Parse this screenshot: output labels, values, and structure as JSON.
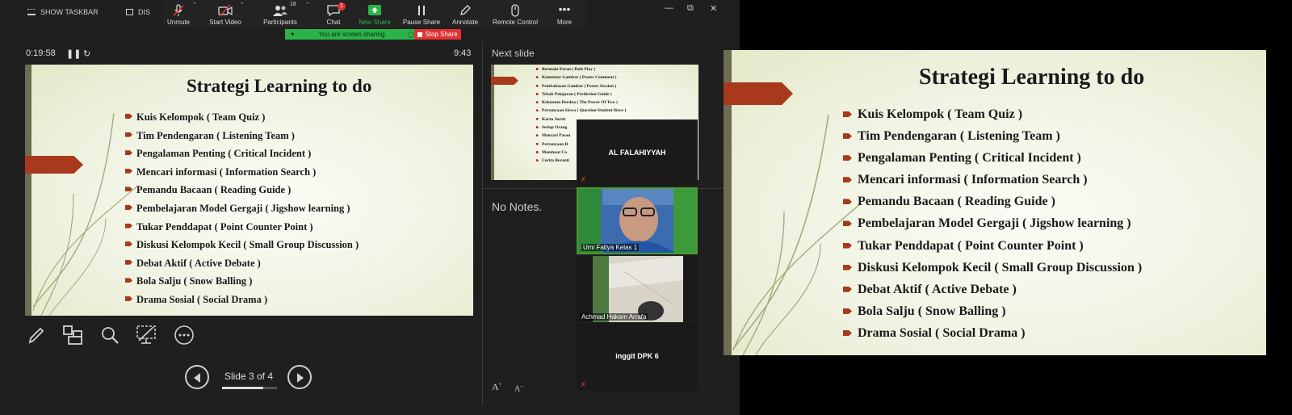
{
  "taskbar": {
    "show_taskbar": "SHOW TASKBAR",
    "disp": "DIS"
  },
  "zoom": {
    "participants_count": "18",
    "chat_badge": "1",
    "items": [
      {
        "label": "Unmute",
        "icon": "mic-muted-icon"
      },
      {
        "label": "Start Video",
        "icon": "video-off-icon"
      },
      {
        "label": "Participants",
        "icon": "participants-icon"
      },
      {
        "label": "Chat",
        "icon": "chat-icon"
      },
      {
        "label": "New Share",
        "icon": "share-icon"
      },
      {
        "label": "Pause Share",
        "icon": "pause-icon"
      },
      {
        "label": "Annotate",
        "icon": "pencil-icon"
      },
      {
        "label": "Remote Control",
        "icon": "mouse-icon"
      },
      {
        "label": "More",
        "icon": "more-icon"
      }
    ],
    "sharing_text": "You are screen sharing",
    "stop_share": "Stop Share",
    "share_color": "#2bb34a",
    "stop_color": "#e03333"
  },
  "presenter": {
    "elapsed": "0:19:58",
    "clock": "9:43",
    "next_slide_label": "Next slide",
    "notes": "No Notes.",
    "slide_counter": "Slide 3 of 4",
    "slide_progress": 0.75,
    "font_increase": "A",
    "font_decrease": "A"
  },
  "slide": {
    "title": "Strategi Learning to do",
    "items": [
      "Kuis Kelompok ( Team Quiz )",
      "Tim Pendengaran ( Listening Team )",
      "Pengalaman Penting ( Critical Incident )",
      "Mencari informasi ( Information Search )",
      "Pemandu Bacaan ( Reading Guide )",
      "Pembelajaran Model Gergaji ( Jigshow learning )",
      "Tukar Penddapat ( Point Counter Point )",
      "Diskusi Kelompok Kecil ( Small Group Discussion )",
      " Debat Aktif ( Active Debate )",
      " Bola Salju ( Snow Balling )",
      "Drama Sosial ( Social Drama )"
    ],
    "accent": "#a8391d"
  },
  "next_slide": {
    "items": [
      "Bermain Peran ( Role Play )",
      "Komentar Gambar ( Poster Comment )",
      "Pembahasan Gambar ( Poster Session )",
      "Tebak Pelajaran ( Prediction Guide )",
      "Kekuatan Berdua ( The Power Of Two )",
      "Pertanyaan Siswa ( Question Student Have )",
      "Kartu Sortir",
      "Setiap Orang",
      "Mencari Pasan",
      "Pertanyaan R",
      "Membuat Co",
      "Cerita Beranti"
    ]
  },
  "participants": {
    "p1": "AL FALAHIYYAH",
    "p2": "Umi Fatiya Kelas 1",
    "p3": "Achmad Hakam Arrafa",
    "p4": "inggit DPK 6"
  }
}
